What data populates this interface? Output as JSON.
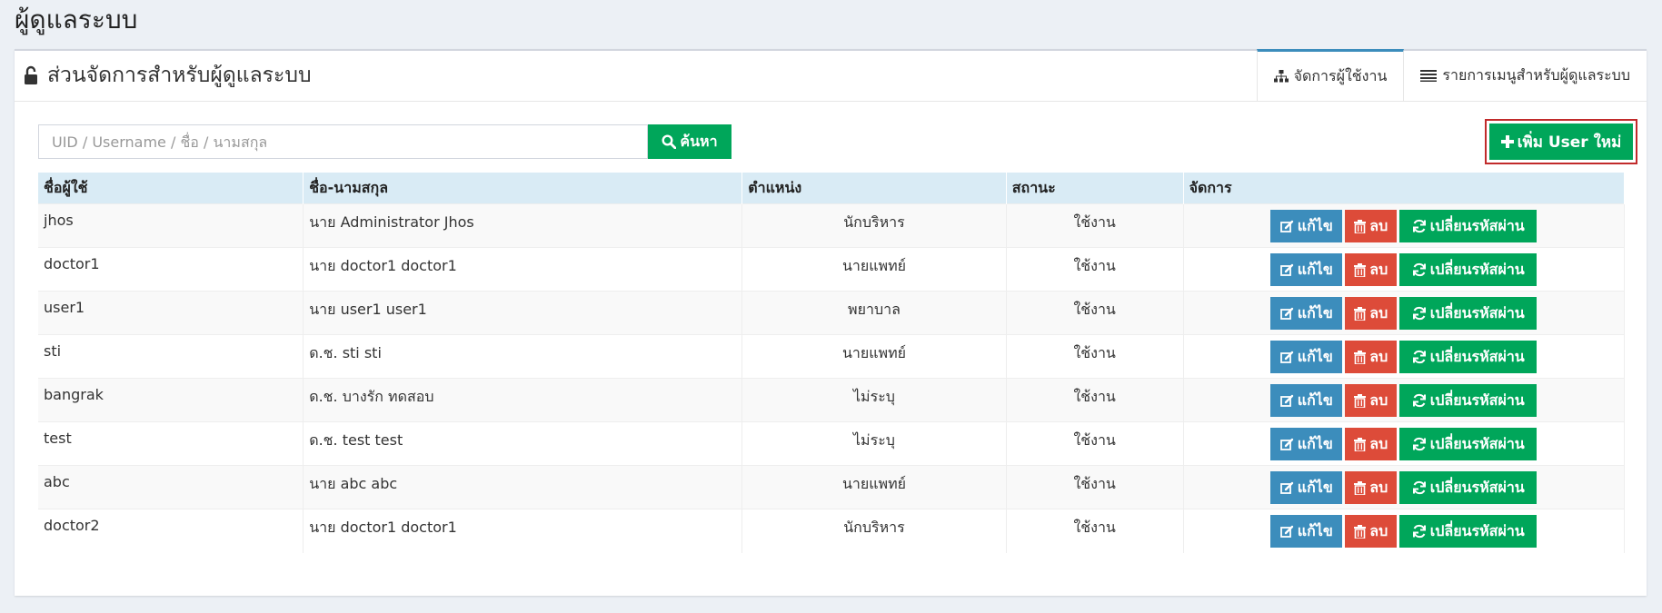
{
  "page": {
    "title": "ผู้ดูแลระบบ"
  },
  "panel": {
    "title": "ส่วนจัดการสำหรับผู้ดูแลระบบ",
    "tabs": [
      {
        "label": "จัดการผู้ใช้งาน",
        "icon": "sitemap-icon",
        "active": true
      },
      {
        "label": "รายการเมนูสำหรับผู้ดูแลระบบ",
        "icon": "list-icon",
        "active": false
      }
    ]
  },
  "search": {
    "placeholder": "UID / Username / ชื่อ / นามสกุล",
    "value": "",
    "button_label": "ค้นหา"
  },
  "add_button_label": "เพิ่ม User ใหม่",
  "table": {
    "headers": [
      "ชื่อผู้ใช้",
      "ชื่อ-นามสกุล",
      "ตำแหน่ง",
      "สถานะ",
      "จัดการ"
    ],
    "action_labels": {
      "edit": "แก้ไข",
      "delete": "ลบ",
      "reset_password": "เปลี่ยนรหัสผ่าน"
    },
    "rows": [
      {
        "username": "jhos",
        "fullname": "นาย Administrator Jhos",
        "position": "นักบริหาร",
        "status": "ใช้งาน"
      },
      {
        "username": "doctor1",
        "fullname": "นาย doctor1 doctor1",
        "position": "นายแพทย์",
        "status": "ใช้งาน"
      },
      {
        "username": "user1",
        "fullname": "นาย user1 user1",
        "position": "พยาบาล",
        "status": "ใช้งาน"
      },
      {
        "username": "sti",
        "fullname": "ด.ช. sti sti",
        "position": "นายแพทย์",
        "status": "ใช้งาน"
      },
      {
        "username": "bangrak",
        "fullname": "ด.ช. บางรัก ทดสอบ",
        "position": "ไม่ระบุ",
        "status": "ใช้งาน"
      },
      {
        "username": "test",
        "fullname": "ด.ช. test test",
        "position": "ไม่ระบุ",
        "status": "ใช้งาน"
      },
      {
        "username": "abc",
        "fullname": "นาย abc abc",
        "position": "นายแพทย์",
        "status": "ใช้งาน"
      },
      {
        "username": "doctor2",
        "fullname": "นาย doctor1 doctor1",
        "position": "นักบริหาร",
        "status": "ใช้งาน"
      }
    ]
  },
  "colors": {
    "success": "#00a65a",
    "primary": "#3c8dbc",
    "danger": "#dd4b39",
    "header_bg": "#d9ebf5",
    "outline": "#c12b2b"
  }
}
